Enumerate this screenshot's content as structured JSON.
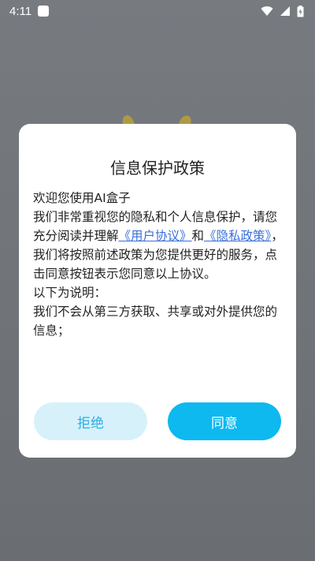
{
  "status_bar": {
    "time": "4:11",
    "icons": [
      "notification-square-icon",
      "wifi-icon",
      "signal-icon",
      "battery-icon"
    ]
  },
  "dialog": {
    "title": "信息保护政策",
    "line_welcome": "欢迎您使用AI盒子",
    "para_intro_1": "我们非常重视您的隐私和个人信息保护，请您充分阅读并理解",
    "link_user_agreement": "《用户协议》",
    "and_text": "和",
    "link_privacy_policy": "《隐私政策》",
    "para_intro_2": "，我们将按照前述政策为您提供更好的服务，点击同意按钮表示您同意以上协议。",
    "line_explain": "以下为说明：",
    "line_item_1": "我们不会从第三方获取、共享或对外提供您的信息；",
    "reject_label": "拒绝",
    "agree_label": "同意"
  },
  "colors": {
    "link": "#3a6fd8",
    "agree_bg": "#0db9ef",
    "reject_bg": "#d7f1fb",
    "reject_text": "#2aaee4"
  }
}
